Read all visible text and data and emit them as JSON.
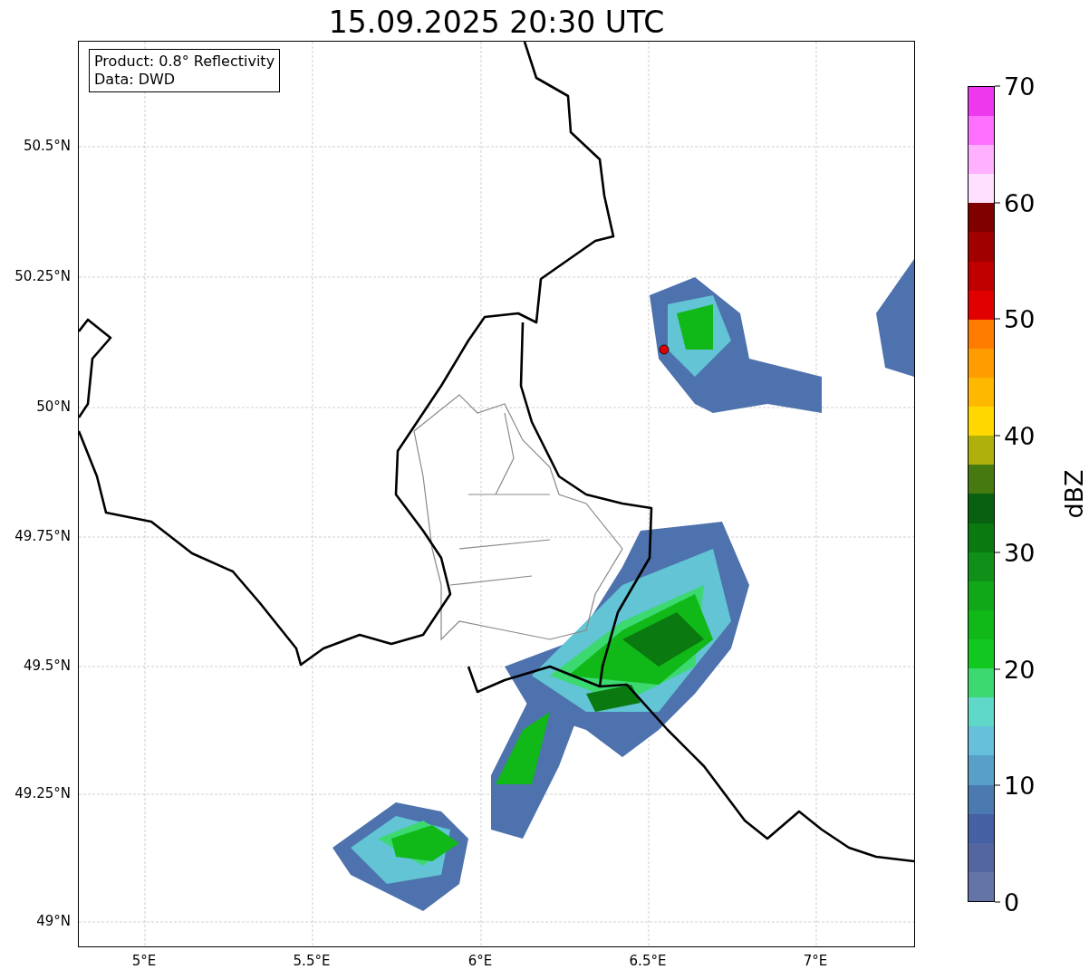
{
  "title": "15.09.2025 20:30 UTC",
  "info_box": [
    "Product: 0.8° Reflectivity",
    "Data: DWD"
  ],
  "map": {
    "y_ticks": [
      "50.5°N",
      "50.25°N",
      "50°N",
      "49.75°N",
      "49.5°N",
      "49.25°N",
      "49°N"
    ],
    "x_ticks": [
      "5°E",
      "5.5°E",
      "6°E",
      "6.5°E",
      "7°E"
    ]
  },
  "colorbar": {
    "label": "dBZ",
    "ticks": [
      "70",
      "60",
      "50",
      "40",
      "30",
      "20",
      "10",
      "0"
    ],
    "bins": [
      {
        "color": "#6474a6"
      },
      {
        "color": "#5466a0"
      },
      {
        "color": "#4560a3"
      },
      {
        "color": "#4a7ab0"
      },
      {
        "color": "#58a0c8"
      },
      {
        "color": "#66c0dc"
      },
      {
        "color": "#60d8c8"
      },
      {
        "color": "#3cd870"
      },
      {
        "color": "#10c820"
      },
      {
        "color": "#10b818"
      },
      {
        "color": "#10a818"
      },
      {
        "color": "#109018"
      },
      {
        "color": "#0a7a10"
      },
      {
        "color": "#086010"
      },
      {
        "color": "#467a10"
      },
      {
        "color": "#b0b00a"
      },
      {
        "color": "#ffd800"
      },
      {
        "color": "#ffb800"
      },
      {
        "color": "#ff9c00"
      },
      {
        "color": "#ff7c00"
      },
      {
        "color": "#e00000"
      },
      {
        "color": "#c00000"
      },
      {
        "color": "#a00000"
      },
      {
        "color": "#800000"
      },
      {
        "color": "#ffe0ff"
      },
      {
        "color": "#ffb0ff"
      },
      {
        "color": "#ff70ff"
      },
      {
        "color": "#ee38ee"
      }
    ]
  }
}
